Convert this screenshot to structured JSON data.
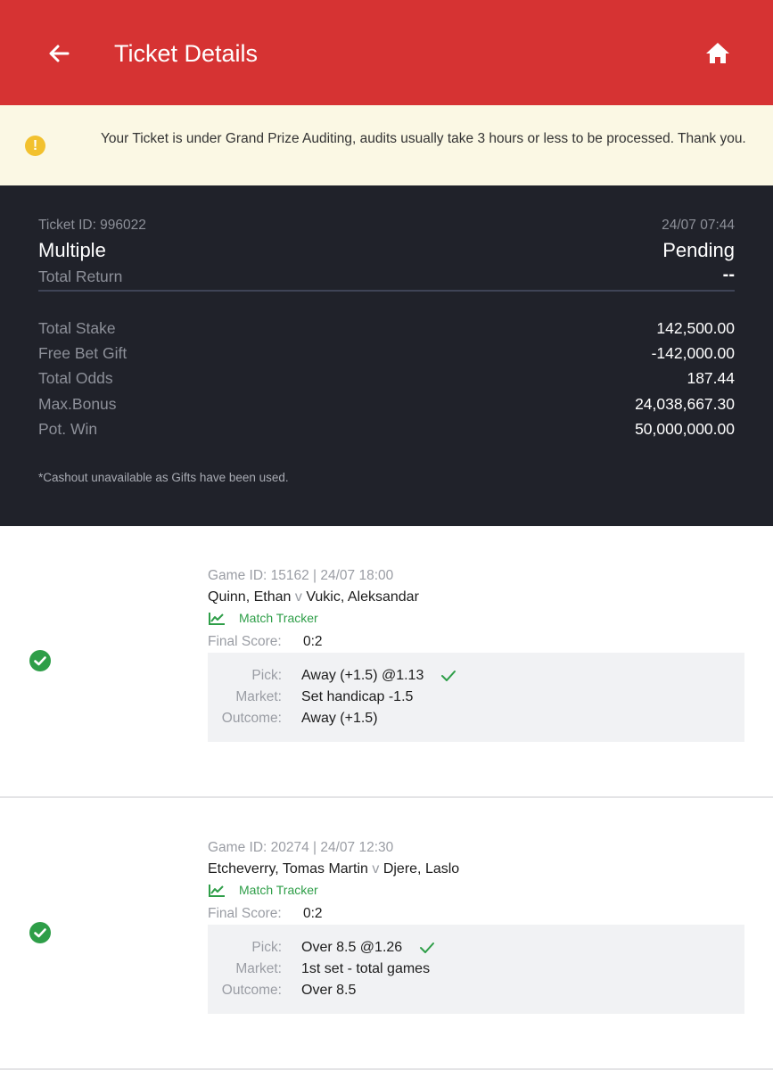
{
  "header": {
    "title": "Ticket Details",
    "accent_color": "#d63333",
    "back_icon": "arrow-left-icon",
    "home_icon": "home-icon"
  },
  "notice": {
    "icon": "exclamation-circle-icon",
    "text": "Your Ticket is under Grand Prize Auditing, audits usually take 3 hours or less to be processed. Thank you."
  },
  "ticket": {
    "id_label": "Ticket ID: 996022",
    "datetime": "24/07 07:44",
    "type": "Multiple",
    "status": "Pending",
    "total_return_label": "Total Return",
    "total_return_value": "--",
    "rows": [
      {
        "label": "Total Stake",
        "value": "142,500.00"
      },
      {
        "label": "Free Bet Gift",
        "value": "-142,000.00"
      },
      {
        "label": "Total Odds",
        "value": "187.44"
      },
      {
        "label": "Max.Bonus",
        "value": "24,038,667.30"
      },
      {
        "label": "Pot. Win",
        "value": "50,000,000.00"
      }
    ],
    "note": "*Cashout unavailable as Gifts have been used."
  },
  "games": [
    {
      "game_id": "Game ID: 15162 | 24/07 18:00",
      "home": "Quinn, Ethan",
      "vs": "v",
      "away": "Vukic, Aleksandar",
      "tracker_label": "Match Tracker",
      "final_score_label": "Final Score:",
      "final_score": "0:2",
      "pick_label": "Pick:",
      "pick": "Away (+1.5) @1.13",
      "market_label": "Market:",
      "market": "Set handicap -1.5",
      "outcome_label": "Outcome:",
      "outcome": "Away (+1.5)"
    },
    {
      "game_id": "Game ID: 20274 | 24/07 12:30",
      "home": "Etcheverry, Tomas Martin",
      "vs": "v",
      "away": "Djere, Laslo",
      "tracker_label": "Match Tracker",
      "final_score_label": "Final Score:",
      "final_score": "0:2",
      "pick_label": "Pick:",
      "pick": "Over 8.5 @1.26",
      "market_label": "Market:",
      "market": "1st set - total games",
      "outcome_label": "Outcome:",
      "outcome": "Over 8.5"
    }
  ]
}
